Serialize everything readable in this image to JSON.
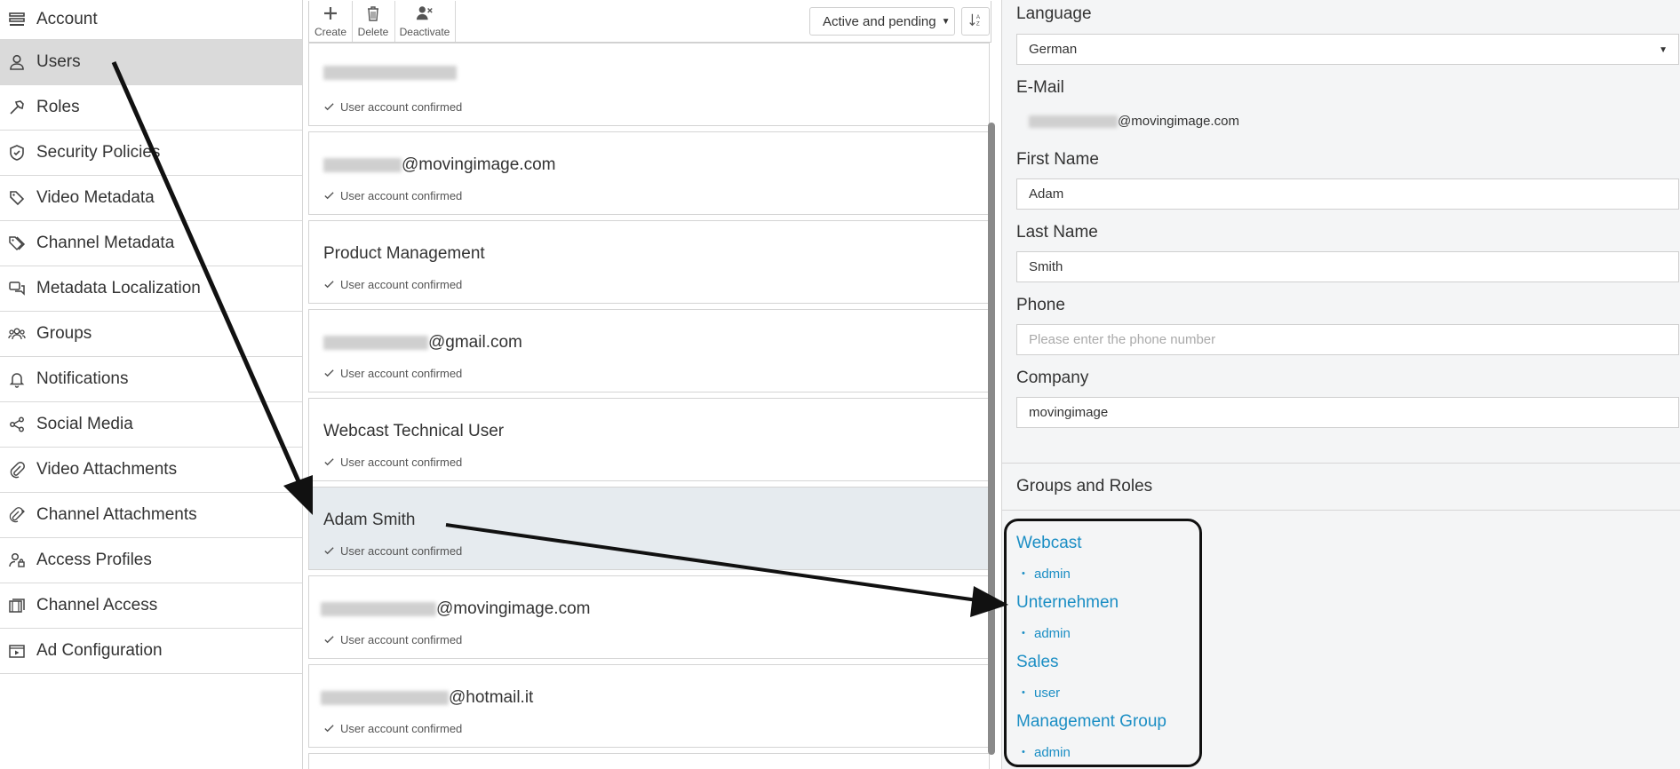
{
  "sidebar": {
    "items": [
      {
        "label": "Account",
        "icon": "list-icon"
      },
      {
        "label": "Users",
        "icon": "user-icon"
      },
      {
        "label": "Roles",
        "icon": "hammer-icon"
      },
      {
        "label": "Security Policies",
        "icon": "shield-icon"
      },
      {
        "label": "Video Metadata",
        "icon": "tag-icon"
      },
      {
        "label": "Channel Metadata",
        "icon": "tags-icon"
      },
      {
        "label": "Metadata Localization",
        "icon": "chat-icon"
      },
      {
        "label": "Groups",
        "icon": "group-icon"
      },
      {
        "label": "Notifications",
        "icon": "bell-icon"
      },
      {
        "label": "Social Media",
        "icon": "share-icon"
      },
      {
        "label": "Video Attachments",
        "icon": "paperclip-icon"
      },
      {
        "label": "Channel Attachments",
        "icon": "double-paperclip-icon"
      },
      {
        "label": "Access Profiles",
        "icon": "user-lock-icon"
      },
      {
        "label": "Channel Access",
        "icon": "film-stack-icon"
      },
      {
        "label": "Ad Configuration",
        "icon": "play-box-icon"
      }
    ],
    "active_index": 1
  },
  "toolbar": {
    "create_label": "Create",
    "delete_label": "Delete",
    "deactivate_label": "Deactivate",
    "filter_value": "Active and pending"
  },
  "users": [
    {
      "name": "",
      "suffix": "",
      "status": "User account confirmed"
    },
    {
      "name": "",
      "suffix": "@movingimage.com",
      "status": "User account confirmed"
    },
    {
      "name": "Product Management",
      "suffix": "",
      "status": "User account confirmed"
    },
    {
      "name": "",
      "suffix": "@gmail.com",
      "status": "User account confirmed"
    },
    {
      "name": "Webcast Technical User",
      "suffix": "",
      "status": "User account confirmed"
    },
    {
      "name": "Adam Smith",
      "suffix": "",
      "status": "User account confirmed",
      "selected": true
    },
    {
      "name": "",
      "suffix": "@movingimage.com",
      "status": "User account confirmed"
    },
    {
      "name": "",
      "suffix": "@hotmail.it",
      "status": "User account confirmed"
    }
  ],
  "detail": {
    "language_label": "Language",
    "language_value": "German",
    "email_label": "E-Mail",
    "email_value_suffix": "@movingimage.com",
    "first_name_label": "First Name",
    "first_name_value": "Adam",
    "last_name_label": "Last Name",
    "last_name_value": "Smith",
    "phone_label": "Phone",
    "phone_placeholder": "Please enter the phone number",
    "company_label": "Company",
    "company_value": "movingimage",
    "groups_roles_title": "Groups and Roles",
    "groups": [
      {
        "name": "Webcast",
        "role": "admin"
      },
      {
        "name": "Unternehmen",
        "role": "admin"
      },
      {
        "name": "Sales",
        "role": "user"
      },
      {
        "name": "Management Group",
        "role": "admin"
      }
    ]
  },
  "colors": {
    "link": "#1b8ec4",
    "active_nav": "#dadada",
    "selected_card": "#e6ebef",
    "detail_bg": "#f4f5f6"
  }
}
